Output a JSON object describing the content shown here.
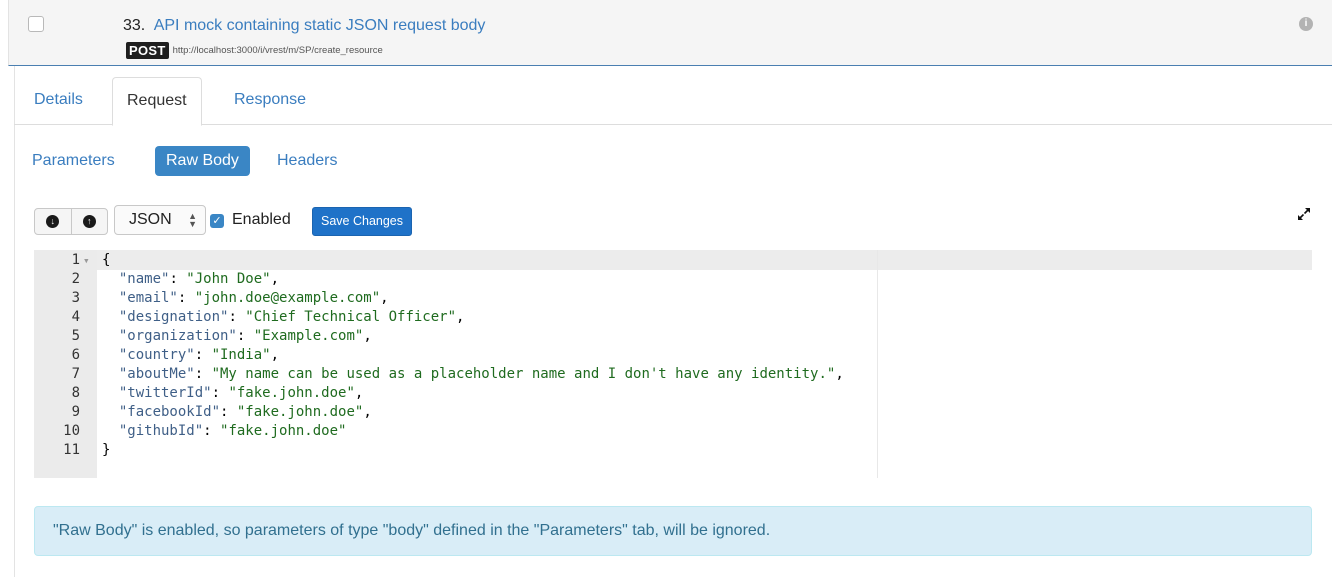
{
  "item": {
    "number": "33.",
    "title": "API mock containing static JSON request body",
    "method": "POST",
    "url": "http://localhost:3000/i/vrest/m/SP/create_resource",
    "info_icon": "info-circle-icon"
  },
  "tabs": [
    "Details",
    "Request",
    "Response"
  ],
  "active_tab": "Request",
  "subtabs": [
    "Parameters",
    "Raw Body",
    "Headers"
  ],
  "active_subtab": "Raw Body",
  "toolbar": {
    "download_icon": "arrow-down-circle-icon",
    "upload_icon": "arrow-up-circle-icon",
    "format_selected": "JSON",
    "enabled_label": "Enabled",
    "enabled_checked": true,
    "save_label": "Save Changes",
    "expand_icon": "expand-icon"
  },
  "editor": {
    "lines": [
      {
        "n": "1",
        "fold": true,
        "text": "{"
      },
      {
        "n": "2",
        "key": "name",
        "value": "John Doe",
        "comma": true
      },
      {
        "n": "3",
        "key": "email",
        "value": "john.doe@example.com",
        "comma": true
      },
      {
        "n": "4",
        "key": "designation",
        "value": "Chief Technical Officer",
        "comma": true
      },
      {
        "n": "5",
        "key": "organization",
        "value": "Example.com",
        "comma": true
      },
      {
        "n": "6",
        "key": "country",
        "value": "India",
        "comma": true
      },
      {
        "n": "7",
        "key": "aboutMe",
        "value": "My name can be used as a placeholder name and I don't have any identity.",
        "comma": true
      },
      {
        "n": "8",
        "key": "twitterId",
        "value": "fake.john.doe",
        "comma": true
      },
      {
        "n": "9",
        "key": "facebookId",
        "value": "fake.john.doe",
        "comma": true
      },
      {
        "n": "10",
        "key": "githubId",
        "value": "fake.john.doe",
        "comma": false
      },
      {
        "n": "11",
        "text": "}"
      }
    ]
  },
  "alert": "\"Raw Body\" is enabled, so parameters of type \"body\" defined in the \"Parameters\" tab, will be ignored."
}
